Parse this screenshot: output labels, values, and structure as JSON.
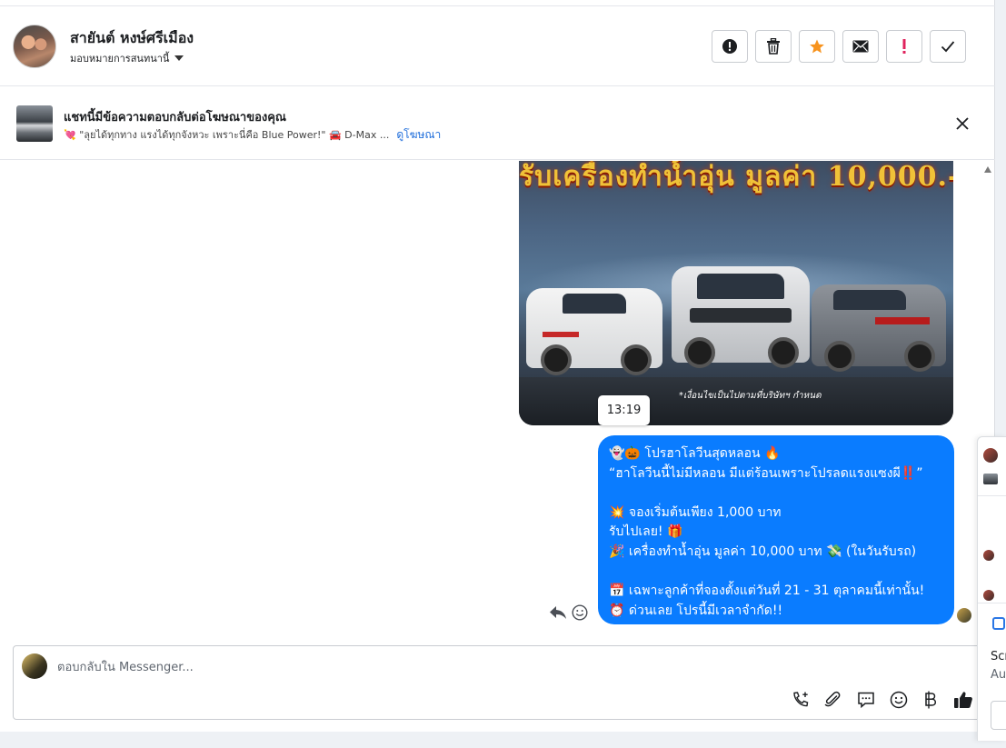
{
  "header": {
    "contact_name": "สายันต์ หงษ์ศรีเมือง",
    "assign_label": "มอบหมายการสนทนานี้",
    "tools": [
      {
        "name": "spam-button",
        "icon": "exclamation-circle-icon"
      },
      {
        "name": "delete-button",
        "icon": "trash-icon"
      },
      {
        "name": "star-button",
        "icon": "star-icon",
        "color": "#f7931e"
      },
      {
        "name": "mark-unread-button",
        "icon": "envelope-icon"
      },
      {
        "name": "follow-up-button",
        "icon": "exclamation-icon",
        "color": "#e0245e"
      },
      {
        "name": "mark-done-button",
        "icon": "check-icon"
      }
    ]
  },
  "ad_banner": {
    "title": "แชทนี้มีข้อความตอบกลับต่อโฆษณาของคุณ",
    "snippet": "💘 \"ลุยได้ทุกทาง แรงได้ทุกจังหวะ เพราะนี่คือ Blue Power!\" 🚘 D-Max ...",
    "link_label": "ดูโฆษณา"
  },
  "messages": {
    "image": {
      "headline": "รับเครื่องทำน้ำอุ่น มูลค่า 10,000.-",
      "footnote": "*เงื่อนไขเป็นไปตามที่บริษัทฯ กำหนด"
    },
    "timestamp": "13:19",
    "bubble_lines": [
      {
        "emoji": "👻🎃",
        "text": " โปรฮาโลวีนสุดหลอน 🔥"
      },
      {
        "emoji": "",
        "text": "“ฮาโลวีนนี้ไม่มีหลอน มีแต่ร้อนเพราะโปรลดแรงแซงผี‼️”"
      },
      {
        "emoji": "",
        "text": ""
      },
      {
        "emoji": "💥",
        "text": " จองเริ่มต้นเพียง 1,000 บาท"
      },
      {
        "emoji": "",
        "text": "รับไปเลย! 🎁"
      },
      {
        "emoji": "🎉",
        "text": " เครื่องทำน้ำอุ่น มูลค่า 10,000 บาท 💸 (ในวันรับรถ)"
      },
      {
        "emoji": "",
        "text": ""
      },
      {
        "emoji": "📅",
        "text": " เฉพาะลูกค้าที่จองตั้งแต่วันที่ 21 - 31 ตุลาคมนี้เท่านั้น!"
      },
      {
        "emoji": "⏰",
        "text": " ด่วนเลย โปรนี้มีเวลาจำกัด!!"
      }
    ]
  },
  "composer": {
    "placeholder": "ตอบกลับใน Messenger...",
    "tools": [
      "add-call-icon",
      "paperclip-icon",
      "saved-replies-icon",
      "emoji-icon",
      "baht-payment-icon",
      "thumbs-up-icon"
    ]
  },
  "side_panel": {
    "text_fragment": "Scr",
    "text_fragment2": "Au"
  },
  "colors": {
    "accent": "#0a7cff",
    "link": "#216fdb",
    "star": "#f7931e",
    "alert": "#e0245e"
  }
}
